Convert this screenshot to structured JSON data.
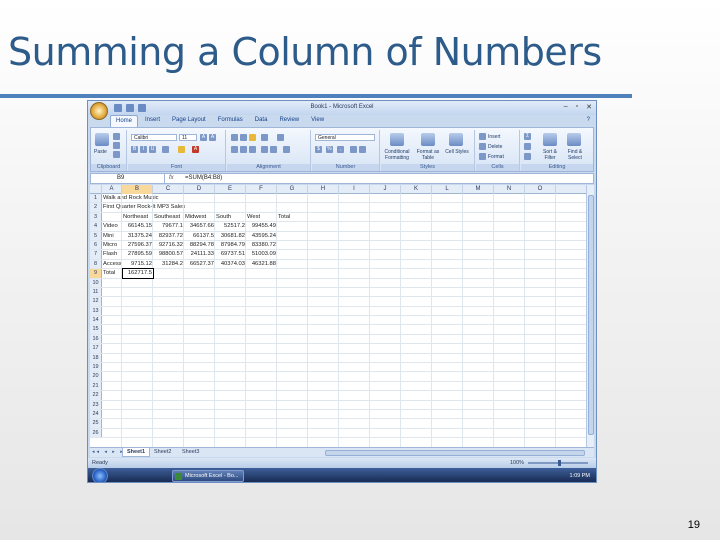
{
  "slide": {
    "title": "Summing a Column of Numbers",
    "page_number": "19"
  },
  "window": {
    "title": "Book1 - Microsoft Excel",
    "controls": [
      "–",
      "▫",
      "✕"
    ]
  },
  "ribbon": {
    "tabs": [
      "Home",
      "Insert",
      "Page Layout",
      "Formulas",
      "Data",
      "Review",
      "View"
    ],
    "active_tab": "Home",
    "groups": {
      "clipboard": {
        "label": "Clipboard",
        "paste": "Paste"
      },
      "font": {
        "label": "Font",
        "font_name": "Calibri",
        "font_size": "11"
      },
      "alignment": {
        "label": "Alignment"
      },
      "number": {
        "label": "Number",
        "format": "General",
        "currency": "$",
        "percent": "%"
      },
      "styles": {
        "label": "Styles",
        "cond_format": "Conditional Formatting",
        "format_table": "Format as Table",
        "cell_styles": "Cell Styles"
      },
      "cells": {
        "label": "Cells",
        "insert": "Insert",
        "delete": "Delete",
        "format": "Format"
      },
      "editing": {
        "label": "Editing",
        "sort_filter": "Sort & Filter",
        "find_select": "Find & Select"
      }
    }
  },
  "formula_bar": {
    "name_box": "B9",
    "fx": "fx",
    "formula": "=SUM(B4:B8)"
  },
  "grid": {
    "columns": [
      "A",
      "B",
      "C",
      "D",
      "E",
      "F",
      "G",
      "H",
      "I",
      "J",
      "K",
      "L",
      "M",
      "N",
      "O"
    ],
    "selected_column": "B",
    "row_numbers": [
      "1",
      "2",
      "3",
      "4",
      "5",
      "6",
      "7",
      "8",
      "9",
      "10",
      "11",
      "12",
      "13",
      "14",
      "15",
      "16",
      "17",
      "18",
      "19",
      "20",
      "21",
      "22",
      "23",
      "24",
      "25",
      "26"
    ],
    "selected_row": "9",
    "rows": [
      [
        "Walk and Rock Music",
        "",
        "",
        "",
        "",
        "",
        ""
      ],
      [
        "First Quarter Rock-It MP3 Sales",
        "",
        "",
        "",
        "",
        "",
        ""
      ],
      [
        "",
        "Northeast",
        "Southeast",
        "Midwest",
        "South",
        "West",
        "Total"
      ],
      [
        "Video",
        "66145.15",
        "79677.1",
        "34657.66",
        "52517.2",
        "99455.49",
        ""
      ],
      [
        "Mini",
        "31375.24",
        "82937.72",
        "66137.5",
        "30681.82",
        "43595.24",
        ""
      ],
      [
        "Micro",
        "27596.37",
        "92716.32",
        "88294.78",
        "87984.79",
        "83380.72",
        ""
      ],
      [
        "Flash",
        "27895.59",
        "98800.57",
        "24111.33",
        "69737.51",
        "51003.09",
        ""
      ],
      [
        "Accessories",
        "9715.12",
        "31284.2",
        "66527.37",
        "40374.03",
        "46321.88",
        ""
      ],
      [
        "Total",
        "162717.5",
        "",
        "",
        "",
        "",
        ""
      ]
    ]
  },
  "sheets": {
    "tabs": [
      "Sheet1",
      "Sheet2",
      "Sheet3"
    ],
    "active": "Sheet1",
    "nav": "◂◂ ◂ ▸ ▸▸"
  },
  "status": {
    "text": "Ready",
    "zoom": "100%"
  },
  "taskbar": {
    "item": "Microsoft Excel - Bo...",
    "time": "1:09 PM"
  }
}
